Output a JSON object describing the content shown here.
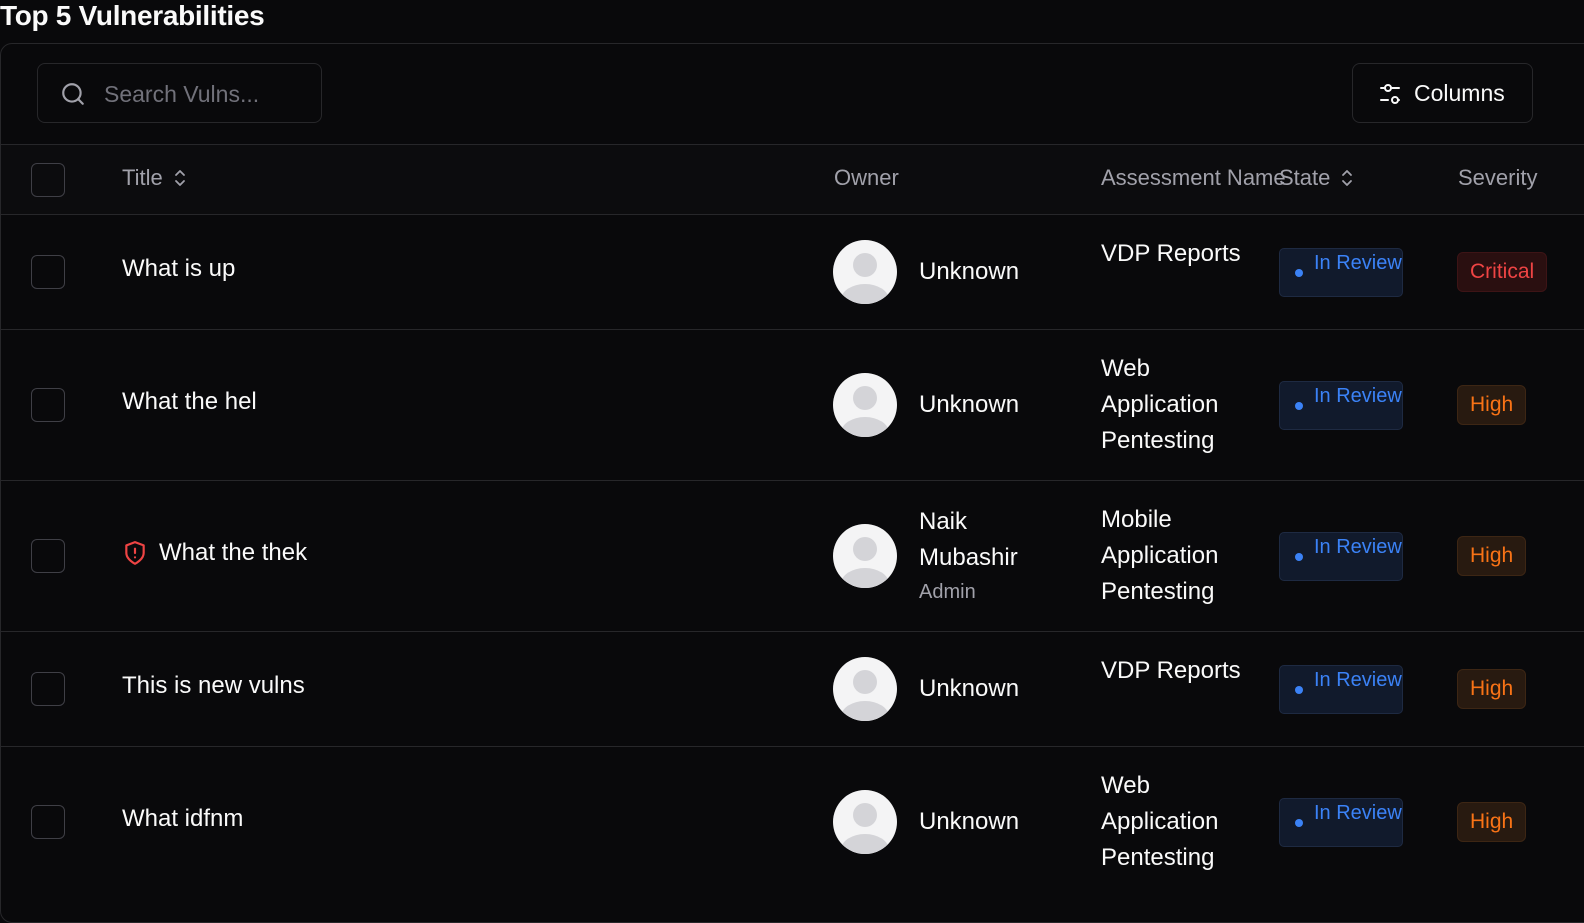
{
  "page": {
    "title": "Top 5 Vulnerabilities"
  },
  "toolbar": {
    "search_placeholder": "Search Vulns...",
    "search_value": "",
    "columns_label": "Columns"
  },
  "table": {
    "headers": {
      "title": "Title",
      "owner": "Owner",
      "assessment": "Assessment Name",
      "state": "State",
      "severity": "Severity"
    },
    "rows": [
      {
        "title": "What is up",
        "owner_name": "Unknown",
        "owner_role": "",
        "assessment": "VDP Reports",
        "state": "In Review",
        "severity": "Critical",
        "icon": ""
      },
      {
        "title": "What the hel",
        "owner_name": "Unknown",
        "owner_role": "",
        "assessment": "Web Application Pentesting",
        "state": "In Review",
        "severity": "High",
        "icon": ""
      },
      {
        "title": "What the thek",
        "owner_name": "Naik Mubashir",
        "owner_role": "Admin",
        "assessment": "Mobile Application Pentesting",
        "state": "In Review",
        "severity": "High",
        "icon": "shield-alert-icon"
      },
      {
        "title": "This is new vulns",
        "owner_name": "Unknown",
        "owner_role": "",
        "assessment": "VDP Reports",
        "state": "In Review",
        "severity": "High",
        "icon": ""
      },
      {
        "title": "What idfnm",
        "owner_name": "Unknown",
        "owner_role": "",
        "assessment": "Web Application Pentesting",
        "state": "In Review",
        "severity": "High",
        "icon": ""
      }
    ]
  },
  "colors": {
    "background": "#09090b",
    "border": "#27272a",
    "state_blue": "#3b82f6",
    "critical_red": "#ef4444",
    "high_orange": "#f97316"
  }
}
